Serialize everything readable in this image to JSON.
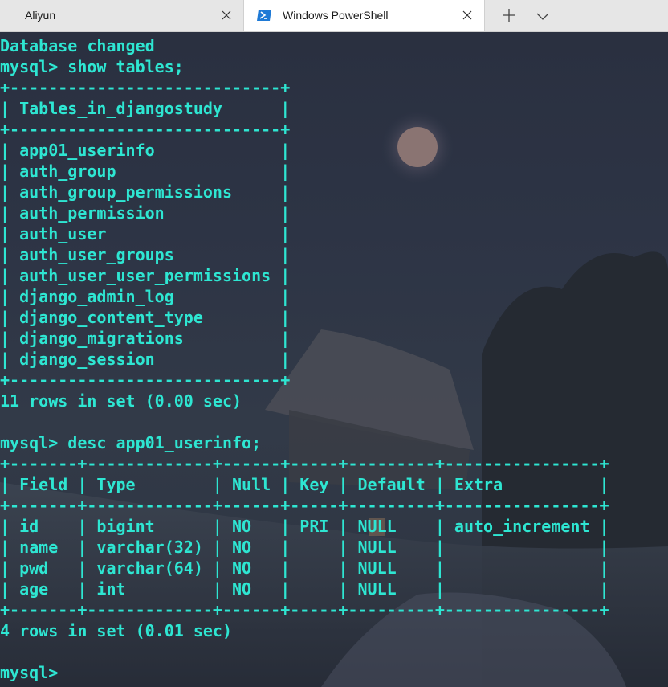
{
  "tabs": [
    {
      "title": "Aliyun",
      "active": false,
      "icon": "close-icon"
    },
    {
      "title": "Windows PowerShell",
      "active": true,
      "icon": "powershell-icon"
    }
  ],
  "colors": {
    "terminal_text": "#2ee6d2",
    "tab_active_bg": "#ffffff",
    "tab_inactive_bg": "#e6e6e6",
    "powershell_icon": "#1f7ad6"
  },
  "terminal": {
    "lines": [
      "Database changed",
      "mysql> show tables;",
      "+----------------------------+",
      "| Tables_in_djangostudy      |",
      "+----------------------------+",
      "| app01_userinfo             |",
      "| auth_group                 |",
      "| auth_group_permissions     |",
      "| auth_permission            |",
      "| auth_user                  |",
      "| auth_user_groups           |",
      "| auth_user_user_permissions |",
      "| django_admin_log           |",
      "| django_content_type        |",
      "| django_migrations          |",
      "| django_session             |",
      "+----------------------------+",
      "11 rows in set (0.00 sec)",
      "",
      "mysql> desc app01_userinfo;",
      "+-------+-------------+------+-----+---------+----------------+",
      "| Field | Type        | Null | Key | Default | Extra          |",
      "+-------+-------------+------+-----+---------+----------------+",
      "| id    | bigint      | NO   | PRI | NULL    | auto_increment |",
      "| name  | varchar(32) | NO   |     | NULL    |                |",
      "| pwd   | varchar(64) | NO   |     | NULL    |                |",
      "| age   | int         | NO   |     | NULL    |                |",
      "+-------+-------------+------+-----+---------+----------------+",
      "4 rows in set (0.01 sec)",
      "",
      "mysql>"
    ]
  }
}
